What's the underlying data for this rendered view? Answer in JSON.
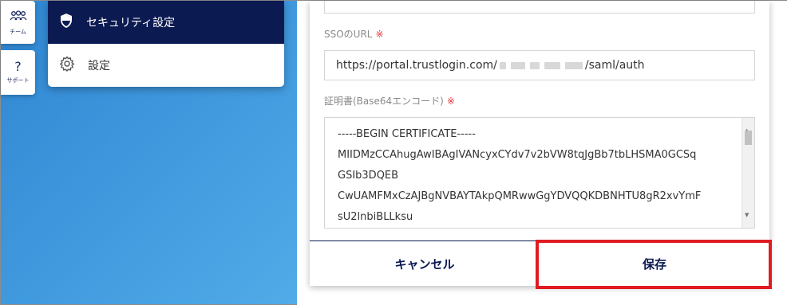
{
  "rail": {
    "team_label": "チーム",
    "support_icon": "?",
    "support_label": "サポート"
  },
  "menu": {
    "items": [
      {
        "label": "セキュリティ設定",
        "icon": "shield-icon",
        "active": true
      },
      {
        "label": "設定",
        "icon": "gear-icon",
        "active": false
      }
    ]
  },
  "form": {
    "sso_url_label": "SSOのURL",
    "required_mark": "※",
    "sso_url_prefix": "https://portal.trustlogin.com/",
    "sso_url_suffix": "/saml/auth",
    "cert_label": "証明書(Base64エンコード)",
    "cert_lines": [
      "-----BEGIN CERTIFICATE-----",
      "MIIDMzCCAhugAwIBAgIVANcyxCYdv7v2bVW8tqJgBb7tbLHSMA0GCSq",
      "GSIb3DQEB",
      "CwUAMFMxCzAJBgNVBAYTAkpQMRwwGgYDVQQKDBNHTU8gR2xvYmF",
      "sU2lnbiBLLksu"
    ]
  },
  "buttons": {
    "cancel": "キャンセル",
    "save": "保存"
  },
  "colors": {
    "navy": "#0c1a52",
    "required": "#e2383d",
    "highlight": "#e01b22"
  }
}
